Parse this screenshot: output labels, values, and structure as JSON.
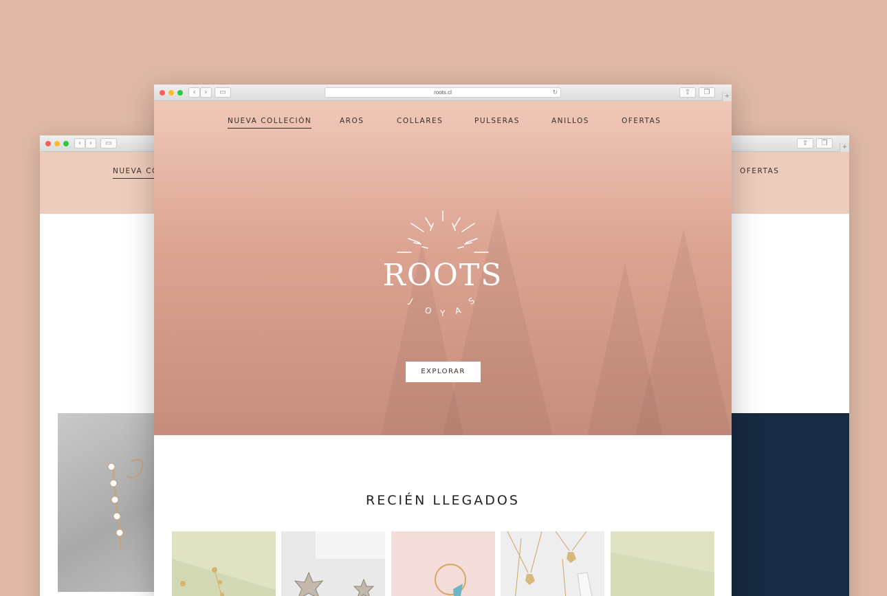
{
  "browser": {
    "url": "roots.cl",
    "back_glyph": "‹",
    "forward_glyph": "›",
    "sidebar_glyph": "▭",
    "share_glyph": "⇪",
    "tabs_glyph": "❐",
    "reload_glyph": "↻",
    "new_tab_glyph": "+"
  },
  "nav": {
    "items": [
      {
        "label": "NUEVA COLLECIÓN",
        "active": true
      },
      {
        "label": "AROS"
      },
      {
        "label": "COLLARES"
      },
      {
        "label": "PULSERAS"
      },
      {
        "label": "ANILLOS"
      },
      {
        "label": "OFERTAS"
      }
    ]
  },
  "left_window": {
    "nav_label": "NUEVA COL"
  },
  "right_window": {
    "nav_label": "OFERTAS"
  },
  "hero": {
    "logo_word": "ROOTS",
    "logo_sub": [
      "J",
      "O",
      "Y",
      "A",
      "S"
    ],
    "cta": "EXPLORAR"
  },
  "new_arrivals": {
    "title": "RECIÉN LLEGADOS"
  },
  "colors": {
    "background": "#e0b9a6",
    "hero_top": "#f0c8b8",
    "hero_bottom": "#c78d7c",
    "navy": "#172a41",
    "text_dark": "#3b2e2a"
  }
}
